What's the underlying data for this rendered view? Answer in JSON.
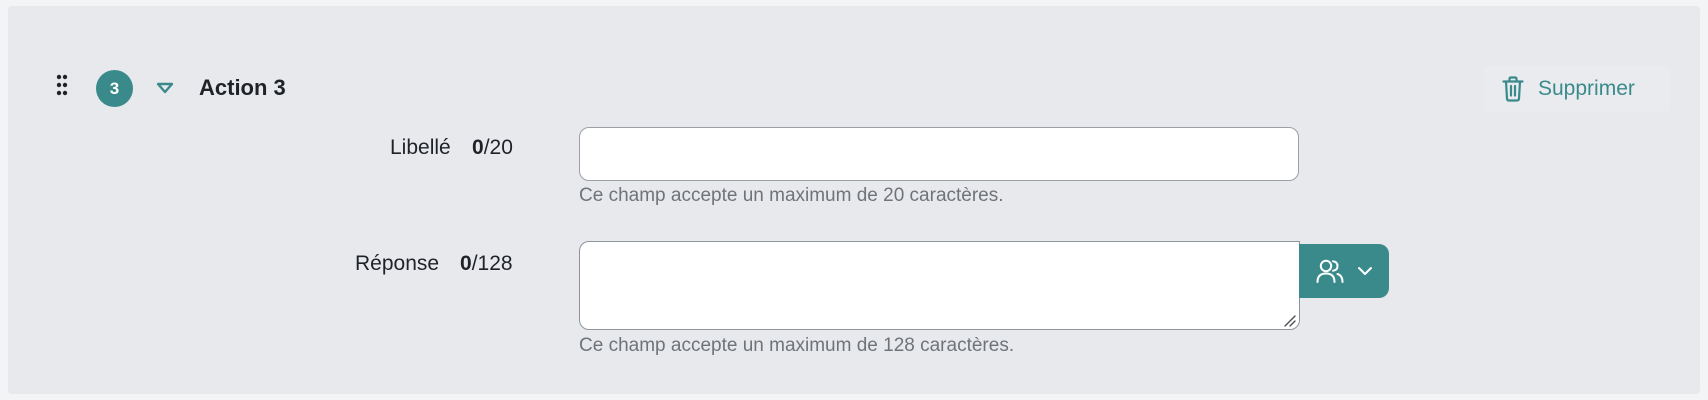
{
  "action": {
    "step_number": "3",
    "title": "Action 3",
    "delete_label": "Supprimer"
  },
  "fields": {
    "label": {
      "name": "Libellé",
      "count": "0",
      "max": "/20",
      "value": "",
      "placeholder": "",
      "hint": "Ce champ accepte un maximum de 20 caractères."
    },
    "response": {
      "name": "Réponse",
      "count": "0",
      "max": "/128",
      "value": "",
      "placeholder": "",
      "hint": "Ce champ accepte un maximum de 128 caractères."
    }
  },
  "colors": {
    "accent": "#3a8a8c",
    "card_background": "#e8e9ed",
    "hint_text": "#6f7479"
  },
  "icons": {
    "drag": "drag-handle-icon",
    "toggle": "caret-down-icon",
    "delete": "trash-icon",
    "variables": "users-icon",
    "dropdown": "chevron-down-icon"
  }
}
